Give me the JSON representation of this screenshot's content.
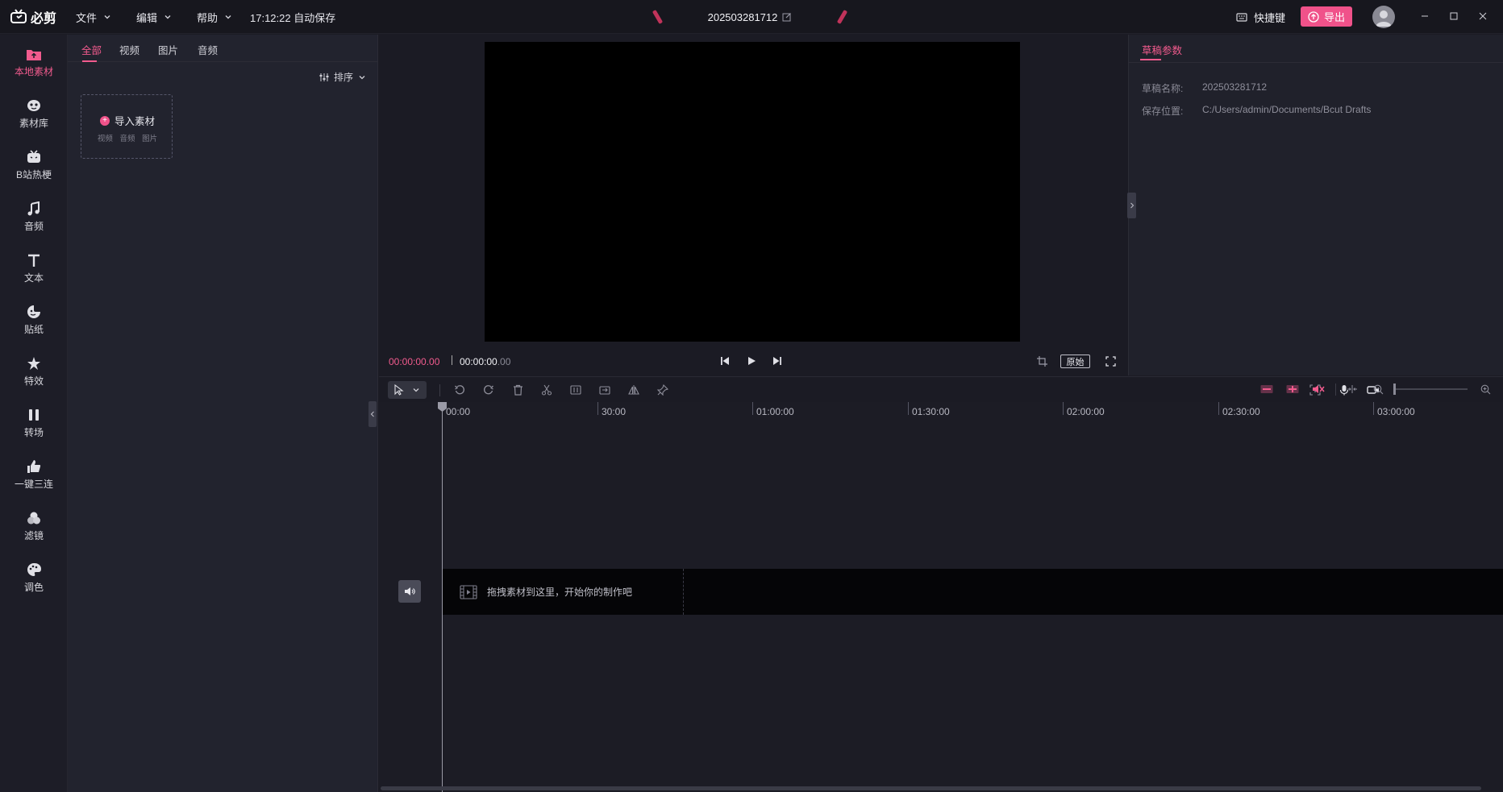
{
  "app": {
    "name": "必剪",
    "menus": [
      "文件",
      "编辑",
      "帮助"
    ],
    "autosave": "17:12:22 自动保存",
    "project_title": "202503281712",
    "shortcut_label": "快捷键",
    "export_label": "导出",
    "accent": "#f0528a"
  },
  "rail": [
    {
      "label": "本地素材",
      "icon": "folder-upload-icon",
      "active": true
    },
    {
      "label": "素材库",
      "icon": "material-library-icon"
    },
    {
      "label": "B站热梗",
      "icon": "bilibili-tv-icon"
    },
    {
      "label": "音频",
      "icon": "music-note-icon"
    },
    {
      "label": "文本",
      "icon": "text-t-icon"
    },
    {
      "label": "贴纸",
      "icon": "sticker-icon"
    },
    {
      "label": "特效",
      "icon": "star-effect-icon"
    },
    {
      "label": "转场",
      "icon": "transition-icon"
    },
    {
      "label": "一键三连",
      "icon": "thumbs-up-icon"
    },
    {
      "label": "滤镜",
      "icon": "filter-icon"
    },
    {
      "label": "调色",
      "icon": "palette-icon"
    }
  ],
  "media": {
    "tabs": [
      "全部",
      "视频",
      "图片",
      "音频"
    ],
    "active_tab": "全部",
    "sort_label": "排序",
    "import_label": "导入素材",
    "import_types": [
      "视频",
      "音频",
      "图片"
    ]
  },
  "preview": {
    "time_current": "00:00:00.00",
    "time_total_main": "00:00:00",
    "time_total_frac": ".00",
    "original_label": "原始"
  },
  "params": {
    "tab": "草稿参数",
    "rows": [
      {
        "key": "草稿名称:",
        "value": "202503281712"
      },
      {
        "key": "保存位置:",
        "value": "C:/Users/admin/Documents/Bcut Drafts"
      }
    ]
  },
  "timeline": {
    "ticks": [
      "00:00",
      "30:00",
      "01:00:00",
      "01:30:00",
      "02:00:00",
      "02:30:00",
      "03:00:00"
    ],
    "drop_hint": "拖拽素材到这里，开始你的制作吧"
  }
}
